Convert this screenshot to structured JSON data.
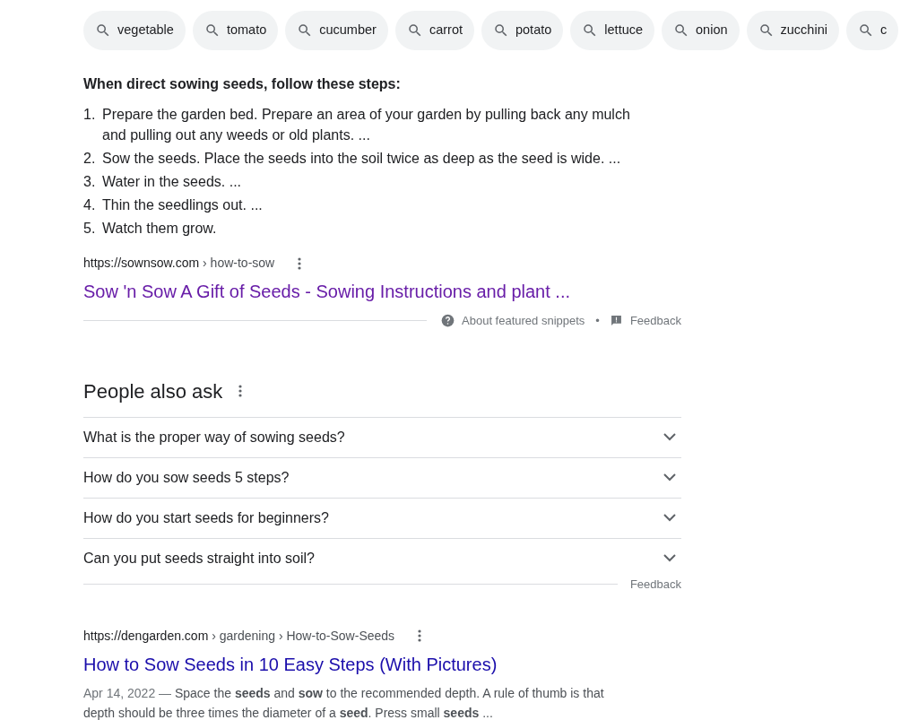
{
  "chips": [
    {
      "label": "vegetable"
    },
    {
      "label": "tomato"
    },
    {
      "label": "cucumber"
    },
    {
      "label": "carrot"
    },
    {
      "label": "potato"
    },
    {
      "label": "lettuce"
    },
    {
      "label": "onion"
    },
    {
      "label": "zucchini"
    },
    {
      "label": "c"
    }
  ],
  "snippet": {
    "heading": "When direct sowing seeds, follow these steps:",
    "steps": [
      {
        "number": "1.",
        "text": "Prepare the garden bed. Prepare an area of your garden by pulling back any mulch and pulling out any weeds or old plants. ..."
      },
      {
        "number": "2.",
        "text": "Sow the seeds. Place the seeds into the soil twice as deep as the seed is wide. ..."
      },
      {
        "number": "3.",
        "text": "Water in the seeds. ..."
      },
      {
        "number": "4.",
        "text": "Thin the seedlings out. ..."
      },
      {
        "number": "5.",
        "text": "Watch them grow."
      }
    ],
    "url": "https://sownsow.com",
    "path": "› how-to-sow",
    "title": "Sow 'n Sow A Gift of Seeds - Sowing Instructions and plant ...",
    "visited": true,
    "about": "About featured snippets",
    "separator": "•",
    "feedback": "Feedback"
  },
  "people_also_ask": {
    "title": "People also ask",
    "questions": [
      {
        "text": "What is the proper way of sowing seeds?",
        "expanded": false
      },
      {
        "text": "How do you sow seeds 5 steps?",
        "expanded": false
      },
      {
        "text": "How do you start seeds for beginners?",
        "expanded": false
      },
      {
        "text": "Can you put seeds straight into soil?",
        "expanded": false
      }
    ],
    "feedback": "Feedback"
  },
  "result": {
    "url": "https://dengarden.com",
    "path": "› gardening › How-to-Sow-Seeds",
    "title": "How to Sow Seeds in 10 Easy Steps (With Pictures)",
    "visited": false,
    "date": "Apr 14, 2022 —",
    "snippet": "Space the **seeds** and **sow** to the recommended depth. A rule of thumb is that depth should be three times the diameter of a **seed**. Press small **seeds** ..."
  }
}
